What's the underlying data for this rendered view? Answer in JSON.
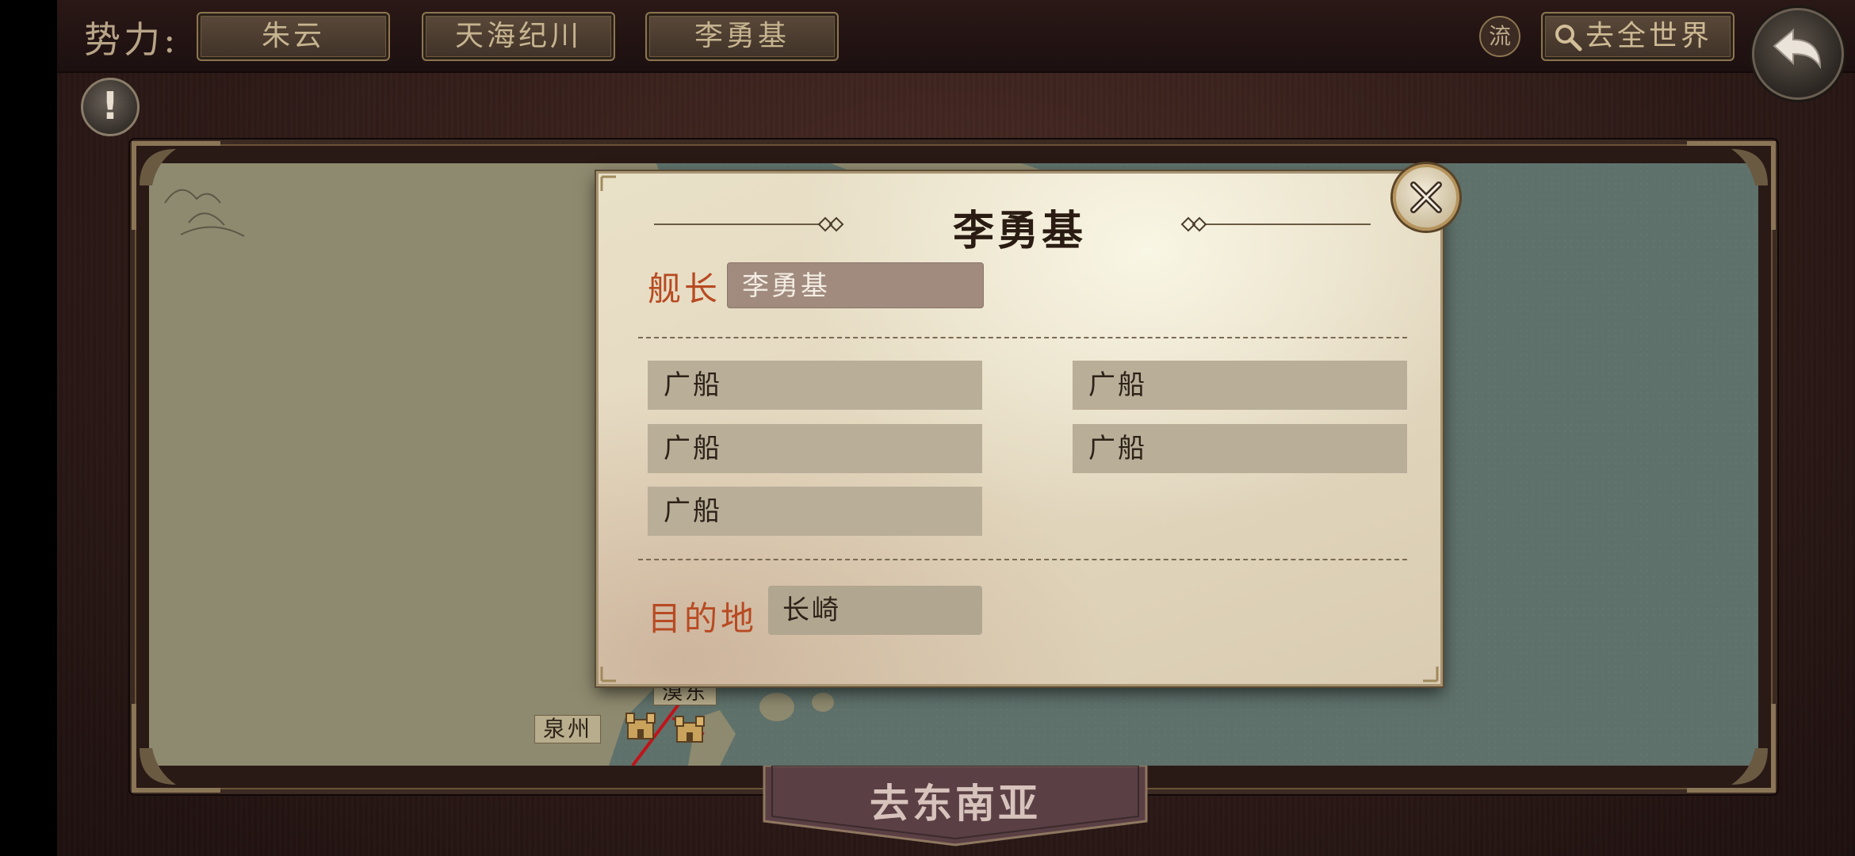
{
  "topbar": {
    "faction_label": "势力:",
    "faction_tabs": [
      "朱云",
      "天海纪川",
      "李勇基"
    ],
    "liu_label": "流",
    "world_button": "去全世界"
  },
  "map": {
    "city_label": "泉州",
    "partial_label": "漠东"
  },
  "dialog": {
    "title": "李勇基",
    "captain_label": "舰长",
    "captain_value": "李勇基",
    "ships": [
      "广船",
      "广船",
      "广船",
      "广船",
      "广船"
    ],
    "destination_label": "目的地",
    "destination_value": "长崎"
  },
  "bottom_tab": {
    "label": "去东南亚"
  },
  "colors": {
    "accent_red": "#b84a22",
    "frame_gold": "#8c7550",
    "sea": "#5c6d67",
    "land": "#8f8a70"
  },
  "icons": [
    "search-icon",
    "back-arrow-icon",
    "alert-icon",
    "close-icon",
    "castle-icon"
  ]
}
